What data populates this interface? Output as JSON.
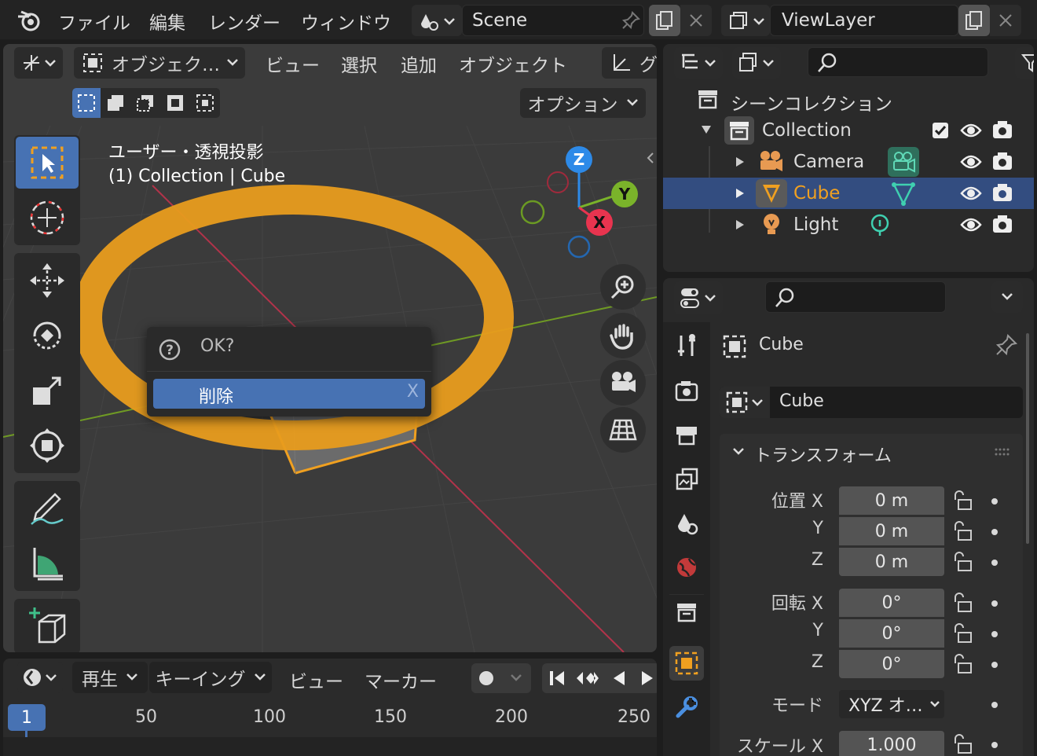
{
  "topbar": {
    "menus": [
      "ファイル",
      "編集",
      "レンダー",
      "ウィンドウ"
    ],
    "scene": "Scene",
    "viewlayer": "ViewLayer"
  },
  "viewport": {
    "mode": "オブジェク…",
    "menus": [
      "ビュー",
      "選択",
      "追加",
      "オブジェクト"
    ],
    "menu_cut": "グ",
    "options": "オプション",
    "view_name": "ユーザー・透視投影",
    "collection_info": "(1) Collection | Cube",
    "gizmo": {
      "x": "X",
      "y": "Y",
      "z": "Z"
    }
  },
  "popup": {
    "title": "OK?",
    "item": "削除",
    "shortcut": "X"
  },
  "timeline": {
    "menus": [
      "再生",
      "キーイング",
      "ビュー",
      "マーカー"
    ],
    "current_frame": "1",
    "ticks": [
      "50",
      "100",
      "150",
      "200",
      "250"
    ]
  },
  "outliner": {
    "scene_collection": "シーンコレクション",
    "collection": "Collection",
    "items": [
      {
        "label": "Camera",
        "selected": false
      },
      {
        "label": "Cube",
        "selected": true
      },
      {
        "label": "Light",
        "selected": false
      }
    ]
  },
  "properties": {
    "object_name": "Cube",
    "data_name": "Cube",
    "panel_title": "トランスフォーム",
    "location_label": "位置 X",
    "rotation_label": "回転 X",
    "y_label": "Y",
    "z_label": "Z",
    "location": [
      "0 m",
      "0 m",
      "0 m"
    ],
    "rotation": [
      "0°",
      "0°",
      "0°"
    ],
    "mode_label": "モード",
    "mode_value": "XYZ オ…",
    "scale_label": "スケール X",
    "scale_x": "1.000"
  },
  "colors": {
    "accent": "#4772b3",
    "selection": "#334d80",
    "highlight": "#f0a020",
    "axis_x": "#e8344f",
    "axis_y": "#7ab32a",
    "axis_z": "#2d8ae8"
  }
}
